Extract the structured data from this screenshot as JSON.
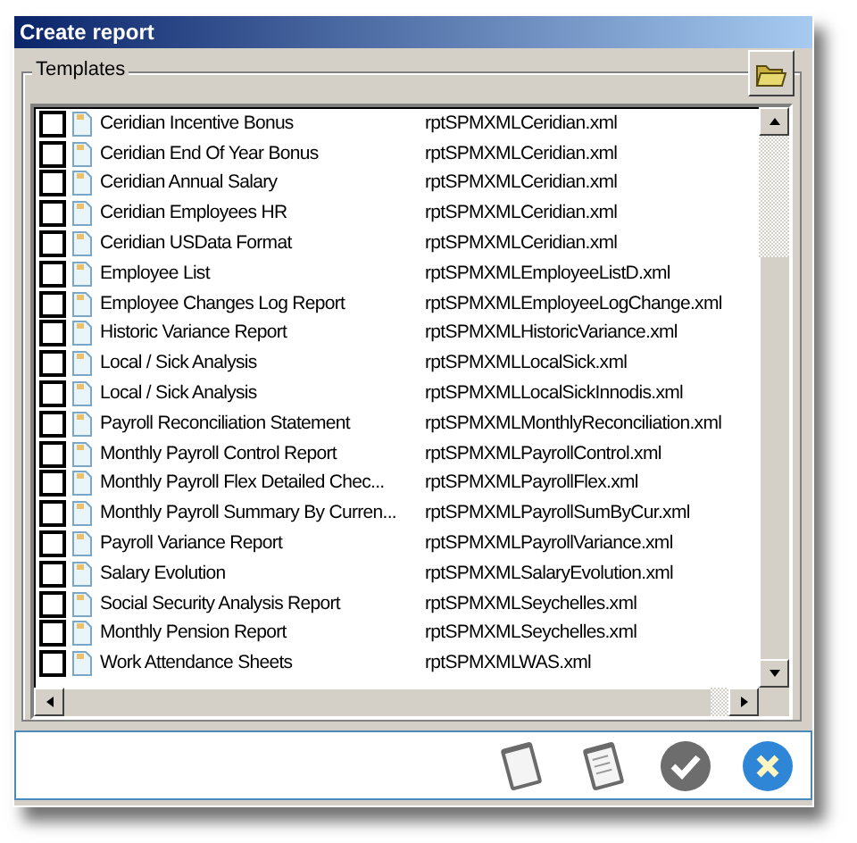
{
  "window": {
    "title": "Create report"
  },
  "group": {
    "label": "Templates"
  },
  "templates": [
    {
      "name": "Ceridian Incentive Bonus",
      "file": "rptSPMXMLCeridian.xml",
      "checked": false
    },
    {
      "name": "Ceridian End Of Year Bonus",
      "file": "rptSPMXMLCeridian.xml",
      "checked": false
    },
    {
      "name": "Ceridian Annual Salary",
      "file": "rptSPMXMLCeridian.xml",
      "checked": false
    },
    {
      "name": "Ceridian Employees HR",
      "file": "rptSPMXMLCeridian.xml",
      "checked": false
    },
    {
      "name": "Ceridian USData Format",
      "file": "rptSPMXMLCeridian.xml",
      "checked": false
    },
    {
      "name": "Employee List",
      "file": "rptSPMXMLEmployeeListD.xml",
      "checked": false
    },
    {
      "name": "Employee Changes Log Report",
      "file": "rptSPMXMLEmployeeLogChange.xml",
      "checked": false
    },
    {
      "name": "Historic Variance Report",
      "file": "rptSPMXMLHistoricVariance.xml",
      "checked": false
    },
    {
      "name": "Local / Sick Analysis",
      "file": "rptSPMXMLLocalSick.xml",
      "checked": false
    },
    {
      "name": "Local / Sick Analysis",
      "file": "rptSPMXMLLocalSickInnodis.xml",
      "checked": false
    },
    {
      "name": "Payroll Reconciliation Statement",
      "file": "rptSPMXMLMonthlyReconciliation.xml",
      "checked": false
    },
    {
      "name": "Monthly Payroll Control Report",
      "file": "rptSPMXMLPayrollControl.xml",
      "checked": false
    },
    {
      "name": "Monthly Payroll Flex Detailed Chec...",
      "file": "rptSPMXMLPayrollFlex.xml",
      "checked": false
    },
    {
      "name": "Monthly Payroll Summary By Curren...",
      "file": "rptSPMXMLPayrollSumByCur.xml",
      "checked": false
    },
    {
      "name": "Payroll Variance Report",
      "file": "rptSPMXMLPayrollVariance.xml",
      "checked": false
    },
    {
      "name": "Salary Evolution",
      "file": "rptSPMXMLSalaryEvolution.xml",
      "checked": false
    },
    {
      "name": "Social Security Analysis Report",
      "file": "rptSPMXMLSeychelles.xml",
      "checked": false
    },
    {
      "name": "Monthly Pension Report",
      "file": "rptSPMXMLSeychelles.xml",
      "checked": false
    },
    {
      "name": "Work Attendance Sheets",
      "file": "rptSPMXMLWAS.xml",
      "checked": false
    }
  ]
}
